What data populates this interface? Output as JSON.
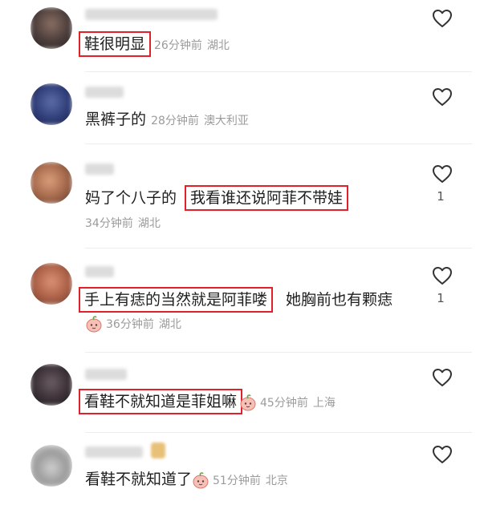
{
  "comments": [
    {
      "text": "鞋很明显",
      "time": "26分钟前",
      "location": "湖北",
      "likes": ""
    },
    {
      "text": "黑裤子的",
      "time": "28分钟前",
      "location": "澳大利亚",
      "likes": ""
    },
    {
      "text": "妈了个八子的",
      "reply_text": "我看谁还说阿菲不带娃",
      "time": "34分钟前",
      "location": "湖北",
      "likes": "1"
    },
    {
      "text": "手上有痣的当然就是阿菲喽",
      "trailing_text": "她胸前也有颗痣",
      "time": "36分钟前",
      "location": "湖北",
      "likes": "1"
    },
    {
      "text": "看鞋不就知道是菲姐嘛",
      "time": "45分钟前",
      "location": "上海",
      "likes": ""
    },
    {
      "text": "看鞋不就知道了",
      "time": "51分钟前",
      "location": "北京",
      "likes": ""
    }
  ],
  "icons": {
    "like": "heart-outline-icon",
    "reaction": "peach-emoji-icon"
  },
  "colors": {
    "highlight_box": "#e2202a",
    "meta_text": "#9b9b9b"
  }
}
